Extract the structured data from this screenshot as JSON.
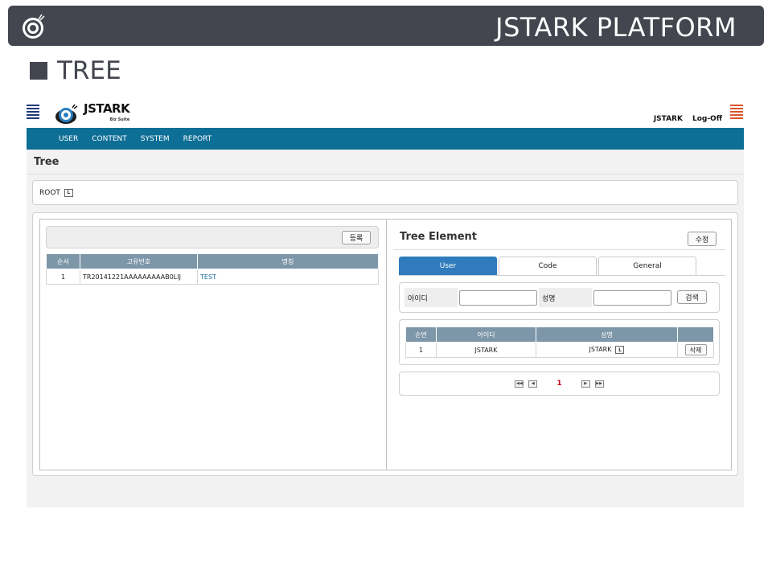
{
  "slide": {
    "title": "JSTARK PLATFORM",
    "section": "TREE"
  },
  "app": {
    "brand": "JSTARK",
    "brand_sub": "Biz Suite",
    "user": "JSTARK",
    "logoff": "Log-Off",
    "nav": [
      "USER",
      "CONTENT",
      "SYSTEM",
      "REPORT"
    ],
    "page_title": "Tree",
    "root_label": "ROOT",
    "tag_icon_glyph": "L"
  },
  "left": {
    "register_button": "등록",
    "columns": [
      "순서",
      "고유번호",
      "명칭"
    ],
    "rows": [
      {
        "order": "1",
        "id": "TR20141221AAAAAAAAAB0LIJ",
        "name": "TEST"
      }
    ]
  },
  "right": {
    "title": "Tree Element",
    "edit_button": "수정",
    "tabs": [
      "User",
      "Code",
      "General"
    ],
    "active_tab": "User",
    "search": {
      "id_label": "아이디",
      "name_label": "성명",
      "id_value": "",
      "name_value": "",
      "button": "검색"
    },
    "columns": [
      "순번",
      "아이디",
      "성명",
      ""
    ],
    "rows": [
      {
        "no": "1",
        "id": "JSTARK",
        "name": "JSTARK",
        "delete": "삭제"
      }
    ],
    "pager": {
      "first": "◀◀",
      "prev": "◀",
      "current": "1",
      "next": "▶",
      "last": "▶▶"
    }
  },
  "colors": {
    "header_bg": "#43464f",
    "nav_bg": "#0e6f96",
    "tab_active": "#2f7bbd",
    "table_header": "#7d97a9",
    "page_active": "#d0021b"
  }
}
